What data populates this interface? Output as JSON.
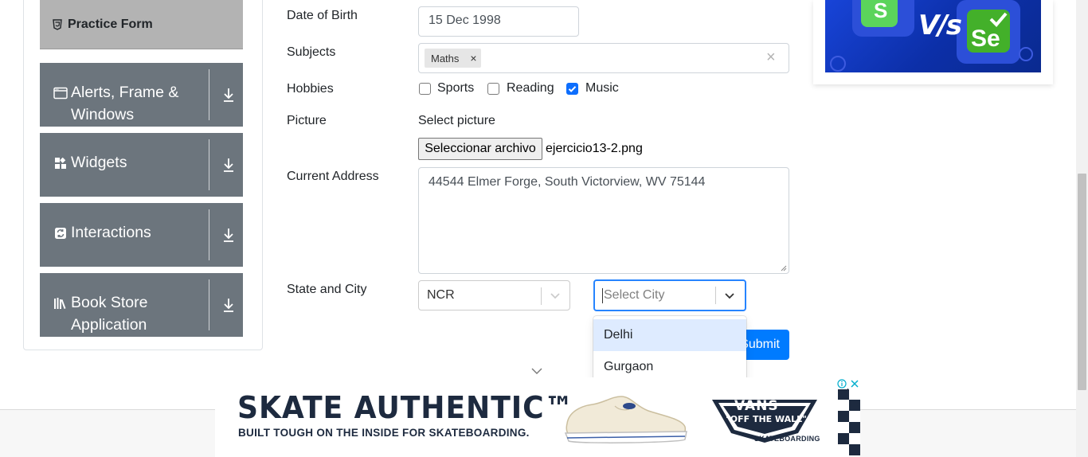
{
  "sidebar": {
    "active_item": "Practice Form",
    "groups": [
      {
        "label_line1": "Alerts, Frame &",
        "label_line2": "Windows",
        "icon": "window-icon"
      },
      {
        "label": "Widgets",
        "icon": "widgets-icon"
      },
      {
        "label": "Interactions",
        "icon": "interactions-icon"
      },
      {
        "label_line1": "Book Store",
        "label_line2": "Application",
        "icon": "books-icon"
      }
    ]
  },
  "form": {
    "dob_label": "Date of Birth",
    "dob_value": "15 Dec 1998",
    "subjects_label": "Subjects",
    "subjects": [
      {
        "label": "Maths",
        "remove": "×"
      }
    ],
    "subjects_clear": "×",
    "hobbies_label": "Hobbies",
    "hobbies": [
      {
        "label": "Sports",
        "checked": false
      },
      {
        "label": "Reading",
        "checked": false
      },
      {
        "label": "Music",
        "checked": true
      }
    ],
    "picture_label": "Picture",
    "picture_select_text": "Select picture",
    "file_button": "Seleccionar archivo",
    "file_name": "ejercicio13-2.png",
    "address_label": "Current Address",
    "address_value": "44544 Elmer Forge, South Victorview, WV 75144",
    "state_city_label": "State and City",
    "state_value": "NCR",
    "city_placeholder": "Select City",
    "city_options": [
      "Delhi",
      "Gurgaon"
    ],
    "submit": "Submit"
  },
  "bottom_ad": {
    "headline": "SKATE AUTHENTIC™",
    "subline": "BUILT TOUGH ON THE INSIDE FOR SKATEBOARDING.",
    "brand_line1": "VANS",
    "brand_line2": "\"OFF THE WALL\"",
    "brand_sub": "SKATEBOARDING"
  },
  "top_ad": {
    "vs_text": "V/s",
    "right_logo_text": "Se"
  },
  "colors": {
    "sidebar_group": "#6c757d",
    "active_item": "#b3b3b3",
    "primary": "#007bff",
    "focus_border": "#2684ff",
    "option_highlight": "#deebff"
  }
}
